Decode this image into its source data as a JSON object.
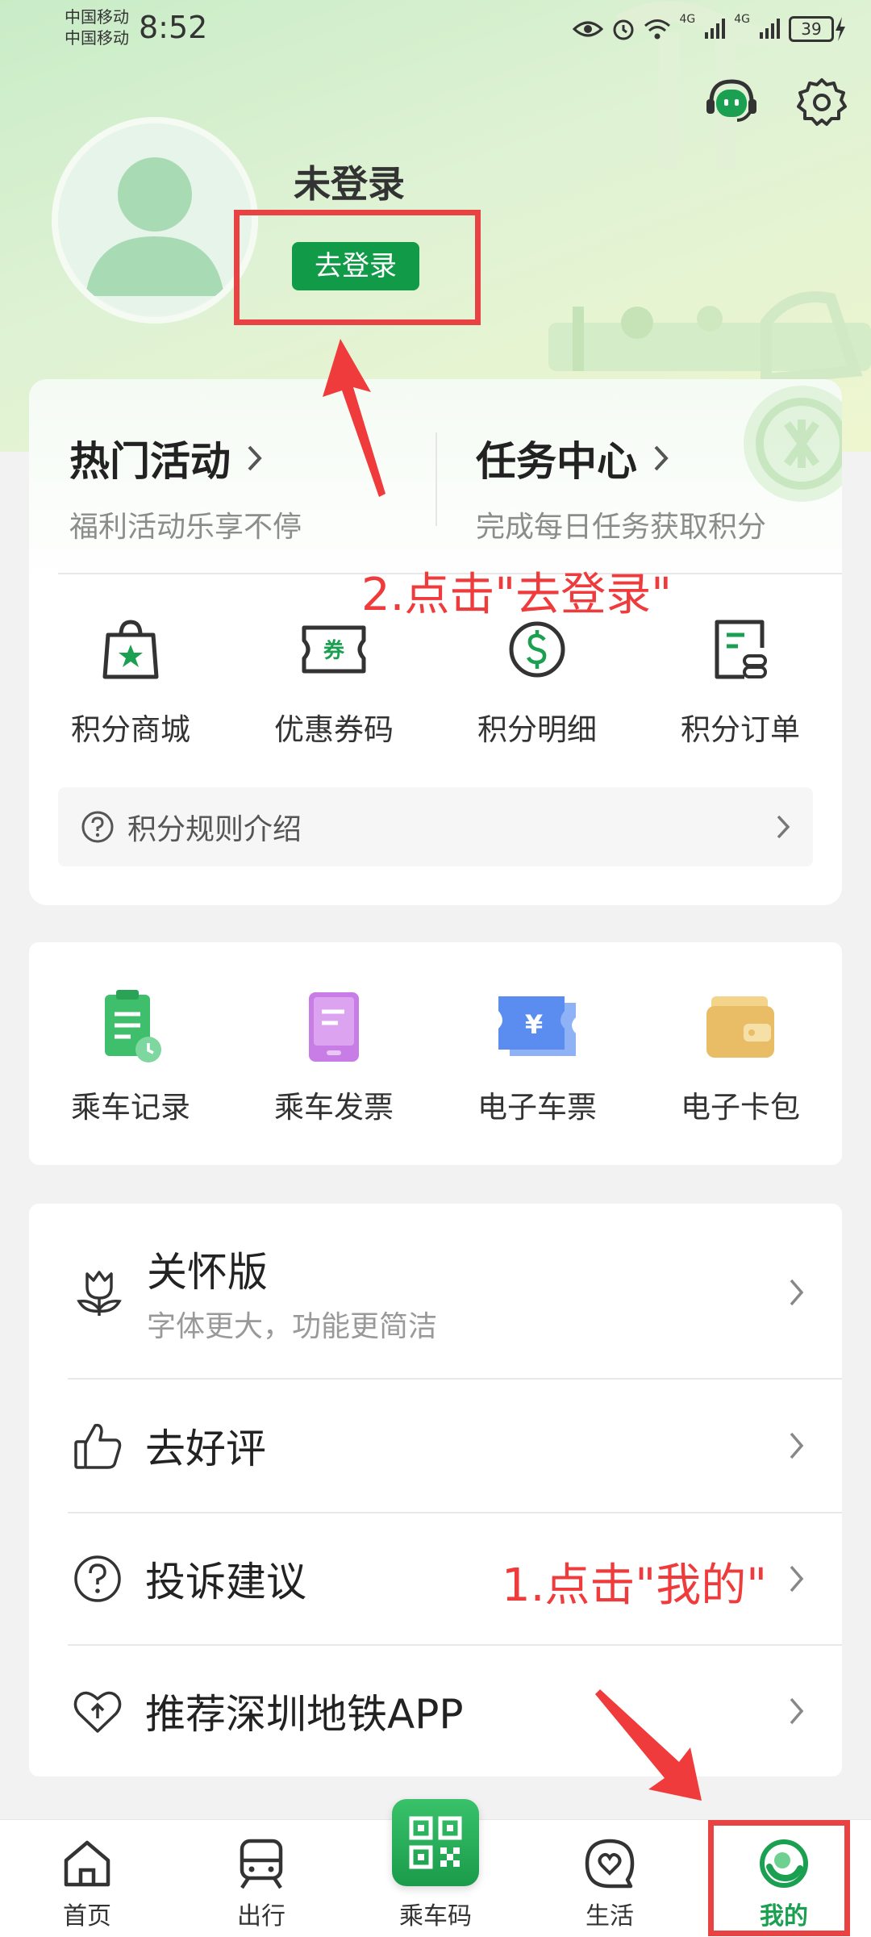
{
  "status_bar": {
    "carrier1": "中国移动",
    "carrier2": "中国移动",
    "time": "8:52",
    "network1": "4G",
    "network2": "4G",
    "battery": "39"
  },
  "profile": {
    "name": "未登录",
    "login_label": "去登录"
  },
  "annotations": {
    "step1": "1.点击\"我的\"",
    "step2": "2.点击\"去登录\""
  },
  "promos": [
    {
      "title": "热门活动",
      "subtitle": "福利活动乐享不停"
    },
    {
      "title": "任务中心",
      "subtitle": "完成每日任务获取积分"
    }
  ],
  "points_grid": [
    {
      "label": "积分商城",
      "icon": "shopping-bag-star-icon"
    },
    {
      "label": "优惠券码",
      "icon": "coupon-icon",
      "badge": "券"
    },
    {
      "label": "积分明细",
      "icon": "dollar-circle-icon"
    },
    {
      "label": "积分订单",
      "icon": "order-list-icon"
    }
  ],
  "rules": {
    "label": "积分规则介绍"
  },
  "ride_grid": [
    {
      "label": "乘车记录",
      "icon": "ride-record-icon"
    },
    {
      "label": "乘车发票",
      "icon": "invoice-icon"
    },
    {
      "label": "电子车票",
      "icon": "e-ticket-icon",
      "badge": "¥"
    },
    {
      "label": "电子卡包",
      "icon": "wallet-icon"
    }
  ],
  "settings": [
    {
      "label": "关怀版",
      "sub": "字体更大，功能更简洁",
      "icon": "tulip-icon"
    },
    {
      "label": "去好评",
      "icon": "thumbs-up-icon"
    },
    {
      "label": "投诉建议",
      "icon": "question-circle-icon"
    },
    {
      "label": "推荐深圳地铁APP",
      "icon": "heart-share-icon"
    }
  ],
  "nav": [
    {
      "label": "首页",
      "icon": "home-icon"
    },
    {
      "label": "出行",
      "icon": "train-icon"
    },
    {
      "label": "乘车码",
      "icon": "qr-code-icon"
    },
    {
      "label": "生活",
      "icon": "heart-bubble-icon"
    },
    {
      "label": "我的",
      "icon": "profile-ring-icon",
      "active": true
    }
  ],
  "colors": {
    "accent": "#119b48",
    "annotation": "#e84242"
  }
}
